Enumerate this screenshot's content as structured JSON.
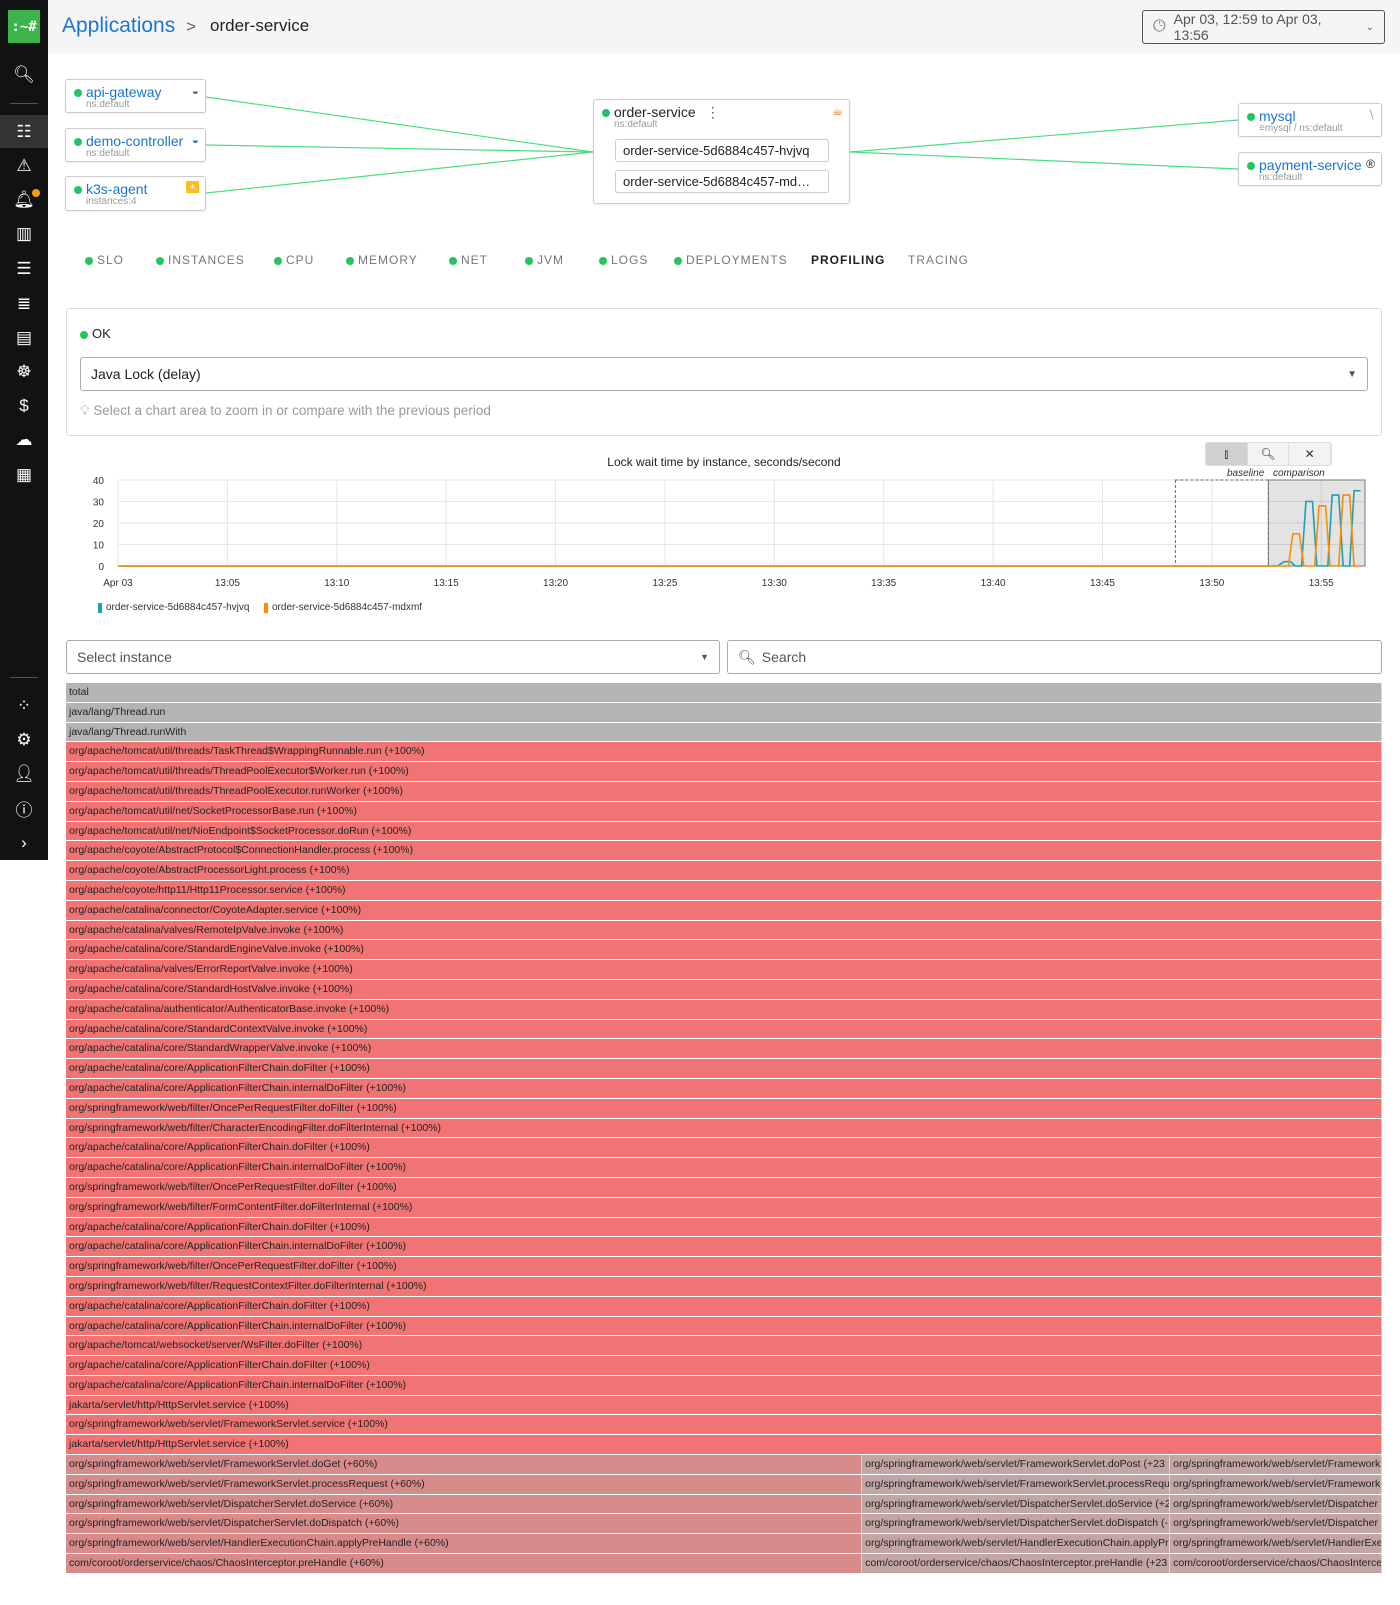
{
  "colors": {
    "accent": "#1976d2",
    "ok": "#22c55e",
    "brand": "#3cb44b",
    "series1": "#17a2b8",
    "series2": "#fd8c00",
    "flame_neutral": "#b4b4b4",
    "flame_increase": "#f07474",
    "flame_partial": "#d88b8b",
    "flame_other": "#c2a6a6"
  },
  "sidebar": {
    "logo": ":~#",
    "icons": [
      "search-icon",
      "apps-grid-icon",
      "alert-icon",
      "bell-icon",
      "map-icon",
      "traces-icon",
      "log-search-icon",
      "nodes-icon",
      "kubernetes-icon",
      "cost-icon",
      "cloud-icon",
      "dashboards-icon",
      "integrations-icon",
      "gear-icon",
      "user-icon",
      "help-icon",
      "chevron-right-icon"
    ],
    "notification_badge": true
  },
  "header": {
    "breadcrumb_root": "Applications",
    "breadcrumb_sep": ">",
    "breadcrumb_current": "order-service",
    "time_range": "Apr 03, 12:59 to Apr 03, 13:56"
  },
  "topology": {
    "upstream": [
      {
        "name": "api-gateway",
        "sub": "ns:default",
        "icon": "python-icon"
      },
      {
        "name": "demo-controller",
        "sub": "ns:default",
        "icon": "python-icon"
      },
      {
        "name": "k3s-agent",
        "sub": "instances:4",
        "icon": "k3s-icon"
      }
    ],
    "center": {
      "name": "order-service",
      "sub": "ns:default",
      "icon": "java-icon",
      "instances": [
        "order-service-5d6884c457-hvjvq",
        "order-service-5d6884c457-md…"
      ]
    },
    "downstream": [
      {
        "name": "mysql",
        "sub": "mysql / ns:default",
        "icon": "mysql-icon"
      },
      {
        "name": "payment-service",
        "sub": "ns:default",
        "icon": "registered-icon"
      }
    ]
  },
  "tabs": [
    {
      "label": "SLO",
      "dot": true
    },
    {
      "label": "INSTANCES",
      "dot": true
    },
    {
      "label": "CPU",
      "dot": true
    },
    {
      "label": "MEMORY",
      "dot": true
    },
    {
      "label": "NET",
      "dot": true
    },
    {
      "label": "JVM",
      "dot": true
    },
    {
      "label": "LOGS",
      "dot": true
    },
    {
      "label": "DEPLOYMENTS",
      "dot": true
    },
    {
      "label": "PROFILING",
      "dot": false,
      "active": true
    },
    {
      "label": "TRACING",
      "dot": false
    }
  ],
  "profiling": {
    "status": "OK",
    "profile_type": "Java Lock (delay)",
    "hint": "Select a chart area to zoom in or compare with the previous period",
    "toolbar_labels": {
      "baseline": "baseline",
      "comparison": "comparison"
    },
    "instance_placeholder": "Select instance",
    "search_placeholder": "Search"
  },
  "chart_data": {
    "type": "line",
    "title": "Lock wait time by instance, seconds/second",
    "ylim": [
      0,
      40
    ],
    "yticks": [
      "0",
      "10",
      "20",
      "30",
      "40"
    ],
    "xlim": [
      "13:00",
      "13:57"
    ],
    "xticks": [
      "Apr 03",
      "13:05",
      "13:10",
      "13:15",
      "13:20",
      "13:25",
      "13:30",
      "13:35",
      "13:40",
      "13:45",
      "13:50",
      "13:55"
    ],
    "grid": true,
    "legend_placement": "bottom-left",
    "baseline_range": [
      "13:48:20",
      "13:52:35"
    ],
    "comparison_range": [
      "13:52:35",
      "13:57:00"
    ],
    "series": [
      {
        "name": "order-service-5d6884c457-hvjvq",
        "color": "#17a2b8",
        "points": [
          [
            "13:00:00",
            0
          ],
          [
            "13:53:00",
            0
          ],
          [
            "13:53:18",
            2
          ],
          [
            "13:53:36",
            2
          ],
          [
            "13:53:48",
            0
          ],
          [
            "13:54:06",
            0
          ],
          [
            "13:54:18",
            30
          ],
          [
            "13:54:36",
            30
          ],
          [
            "13:54:48",
            0
          ],
          [
            "13:55:18",
            0
          ],
          [
            "13:55:30",
            33
          ],
          [
            "13:55:48",
            33
          ],
          [
            "13:56:00",
            0
          ],
          [
            "13:56:18",
            0
          ],
          [
            "13:56:30",
            35
          ],
          [
            "13:56:48",
            35
          ]
        ]
      },
      {
        "name": "order-service-5d6884c457-mdxmf",
        "color": "#fd8c00",
        "points": [
          [
            "13:00:00",
            0
          ],
          [
            "13:53:30",
            0
          ],
          [
            "13:53:42",
            15
          ],
          [
            "13:54:00",
            15
          ],
          [
            "13:54:12",
            0
          ],
          [
            "13:54:42",
            0
          ],
          [
            "13:54:54",
            28
          ],
          [
            "13:55:12",
            28
          ],
          [
            "13:55:24",
            0
          ],
          [
            "13:55:48",
            0
          ],
          [
            "13:56:00",
            33
          ],
          [
            "13:56:18",
            33
          ],
          [
            "13:56:30",
            0
          ],
          [
            "13:56:48",
            0
          ]
        ]
      }
    ]
  },
  "flamegraph": {
    "rows": [
      [
        {
          "label": "total",
          "share": 1,
          "kind": "neutral"
        }
      ],
      [
        {
          "label": "java/lang/Thread.run",
          "share": 1,
          "kind": "neutral"
        }
      ],
      [
        {
          "label": "java/lang/Thread.runWith",
          "share": 1,
          "kind": "neutral"
        }
      ],
      [
        {
          "label": "org/apache/tomcat/util/threads/TaskThread$WrappingRunnable.run (+100%)",
          "share": 1,
          "kind": "increase"
        }
      ],
      [
        {
          "label": "org/apache/tomcat/util/threads/ThreadPoolExecutor$Worker.run (+100%)",
          "share": 1,
          "kind": "increase"
        }
      ],
      [
        {
          "label": "org/apache/tomcat/util/threads/ThreadPoolExecutor.runWorker (+100%)",
          "share": 1,
          "kind": "increase"
        }
      ],
      [
        {
          "label": "org/apache/tomcat/util/net/SocketProcessorBase.run (+100%)",
          "share": 1,
          "kind": "increase"
        }
      ],
      [
        {
          "label": "org/apache/tomcat/util/net/NioEndpoint$SocketProcessor.doRun (+100%)",
          "share": 1,
          "kind": "increase"
        }
      ],
      [
        {
          "label": "org/apache/coyote/AbstractProtocol$ConnectionHandler.process (+100%)",
          "share": 1,
          "kind": "increase"
        }
      ],
      [
        {
          "label": "org/apache/coyote/AbstractProcessorLight.process (+100%)",
          "share": 1,
          "kind": "increase"
        }
      ],
      [
        {
          "label": "org/apache/coyote/http11/Http11Processor.service (+100%)",
          "share": 1,
          "kind": "increase"
        }
      ],
      [
        {
          "label": "org/apache/catalina/connector/CoyoteAdapter.service (+100%)",
          "share": 1,
          "kind": "increase"
        }
      ],
      [
        {
          "label": "org/apache/catalina/valves/RemoteIpValve.invoke (+100%)",
          "share": 1,
          "kind": "increase"
        }
      ],
      [
        {
          "label": "org/apache/catalina/core/StandardEngineValve.invoke (+100%)",
          "share": 1,
          "kind": "increase"
        }
      ],
      [
        {
          "label": "org/apache/catalina/valves/ErrorReportValve.invoke (+100%)",
          "share": 1,
          "kind": "increase"
        }
      ],
      [
        {
          "label": "org/apache/catalina/core/StandardHostValve.invoke (+100%)",
          "share": 1,
          "kind": "increase"
        }
      ],
      [
        {
          "label": "org/apache/catalina/authenticator/AuthenticatorBase.invoke (+100%)",
          "share": 1,
          "kind": "increase"
        }
      ],
      [
        {
          "label": "org/apache/catalina/core/StandardContextValve.invoke (+100%)",
          "share": 1,
          "kind": "increase"
        }
      ],
      [
        {
          "label": "org/apache/catalina/core/StandardWrapperValve.invoke (+100%)",
          "share": 1,
          "kind": "increase"
        }
      ],
      [
        {
          "label": "org/apache/catalina/core/ApplicationFilterChain.doFilter (+100%)",
          "share": 1,
          "kind": "increase"
        }
      ],
      [
        {
          "label": "org/apache/catalina/core/ApplicationFilterChain.internalDoFilter (+100%)",
          "share": 1,
          "kind": "increase"
        }
      ],
      [
        {
          "label": "org/springframework/web/filter/OncePerRequestFilter.doFilter (+100%)",
          "share": 1,
          "kind": "increase"
        }
      ],
      [
        {
          "label": "org/springframework/web/filter/CharacterEncodingFilter.doFilterInternal (+100%)",
          "share": 1,
          "kind": "increase"
        }
      ],
      [
        {
          "label": "org/apache/catalina/core/ApplicationFilterChain.doFilter (+100%)",
          "share": 1,
          "kind": "increase"
        }
      ],
      [
        {
          "label": "org/apache/catalina/core/ApplicationFilterChain.internalDoFilter (+100%)",
          "share": 1,
          "kind": "increase"
        }
      ],
      [
        {
          "label": "org/springframework/web/filter/OncePerRequestFilter.doFilter (+100%)",
          "share": 1,
          "kind": "increase"
        }
      ],
      [
        {
          "label": "org/springframework/web/filter/FormContentFilter.doFilterInternal (+100%)",
          "share": 1,
          "kind": "increase"
        }
      ],
      [
        {
          "label": "org/apache/catalina/core/ApplicationFilterChain.doFilter (+100%)",
          "share": 1,
          "kind": "increase"
        }
      ],
      [
        {
          "label": "org/apache/catalina/core/ApplicationFilterChain.internalDoFilter (+100%)",
          "share": 1,
          "kind": "increase"
        }
      ],
      [
        {
          "label": "org/springframework/web/filter/OncePerRequestFilter.doFilter (+100%)",
          "share": 1,
          "kind": "increase"
        }
      ],
      [
        {
          "label": "org/springframework/web/filter/RequestContextFilter.doFilterInternal (+100%)",
          "share": 1,
          "kind": "increase"
        }
      ],
      [
        {
          "label": "org/apache/catalina/core/ApplicationFilterChain.doFilter (+100%)",
          "share": 1,
          "kind": "increase"
        }
      ],
      [
        {
          "label": "org/apache/catalina/core/ApplicationFilterChain.internalDoFilter (+100%)",
          "share": 1,
          "kind": "increase"
        }
      ],
      [
        {
          "label": "org/apache/tomcat/websocket/server/WsFilter.doFilter (+100%)",
          "share": 1,
          "kind": "increase"
        }
      ],
      [
        {
          "label": "org/apache/catalina/core/ApplicationFilterChain.doFilter (+100%)",
          "share": 1,
          "kind": "increase"
        }
      ],
      [
        {
          "label": "org/apache/catalina/core/ApplicationFilterChain.internalDoFilter (+100%)",
          "share": 1,
          "kind": "increase"
        }
      ],
      [
        {
          "label": "jakarta/servlet/http/HttpServlet.service (+100%)",
          "share": 1,
          "kind": "increase"
        }
      ],
      [
        {
          "label": "org/springframework/web/servlet/FrameworkServlet.service (+100%)",
          "share": 1,
          "kind": "increase"
        }
      ],
      [
        {
          "label": "jakarta/servlet/http/HttpServlet.service (+100%)",
          "share": 1,
          "kind": "increase"
        }
      ],
      [
        {
          "label": "org/springframework/web/servlet/FrameworkServlet.doGet (+60%)",
          "share": 0.605,
          "kind": "partial"
        },
        {
          "label": "org/springframework/web/servlet/FrameworkServlet.doPost (+23",
          "share": 0.234,
          "kind": "other"
        },
        {
          "label": "org/springframework/web/servlet/Framework",
          "share": 0.161,
          "kind": "other"
        }
      ],
      [
        {
          "label": "org/springframework/web/servlet/FrameworkServlet.processRequest (+60%)",
          "share": 0.605,
          "kind": "partial"
        },
        {
          "label": "org/springframework/web/servlet/FrameworkServlet.processRequ",
          "share": 0.234,
          "kind": "other"
        },
        {
          "label": "org/springframework/web/servlet/Framework",
          "share": 0.161,
          "kind": "other"
        }
      ],
      [
        {
          "label": "org/springframework/web/servlet/DispatcherServlet.doService (+60%)",
          "share": 0.605,
          "kind": "partial"
        },
        {
          "label": "org/springframework/web/servlet/DispatcherServlet.doService (+2",
          "share": 0.234,
          "kind": "other"
        },
        {
          "label": "org/springframework/web/servlet/Dispatcher",
          "share": 0.161,
          "kind": "other"
        }
      ],
      [
        {
          "label": "org/springframework/web/servlet/DispatcherServlet.doDispatch (+60%)",
          "share": 0.605,
          "kind": "partial"
        },
        {
          "label": "org/springframework/web/servlet/DispatcherServlet.doDispatch (-",
          "share": 0.234,
          "kind": "other"
        },
        {
          "label": "org/springframework/web/servlet/Dispatcher",
          "share": 0.161,
          "kind": "other"
        }
      ],
      [
        {
          "label": "org/springframework/web/servlet/HandlerExecutionChain.applyPreHandle (+60%)",
          "share": 0.605,
          "kind": "partial"
        },
        {
          "label": "org/springframework/web/servlet/HandlerExecutionChain.applyPr",
          "share": 0.234,
          "kind": "other"
        },
        {
          "label": "org/springframework/web/servlet/HandlerExe",
          "share": 0.161,
          "kind": "other"
        }
      ],
      [
        {
          "label": "com/coroot/orderservice/chaos/ChaosInterceptor.preHandle (+60%)",
          "share": 0.605,
          "kind": "partial"
        },
        {
          "label": "com/coroot/orderservice/chaos/ChaosInterceptor.preHandle (+23",
          "share": 0.234,
          "kind": "other"
        },
        {
          "label": "com/coroot/orderservice/chaos/ChaosInterce",
          "share": 0.161,
          "kind": "other"
        }
      ]
    ]
  }
}
